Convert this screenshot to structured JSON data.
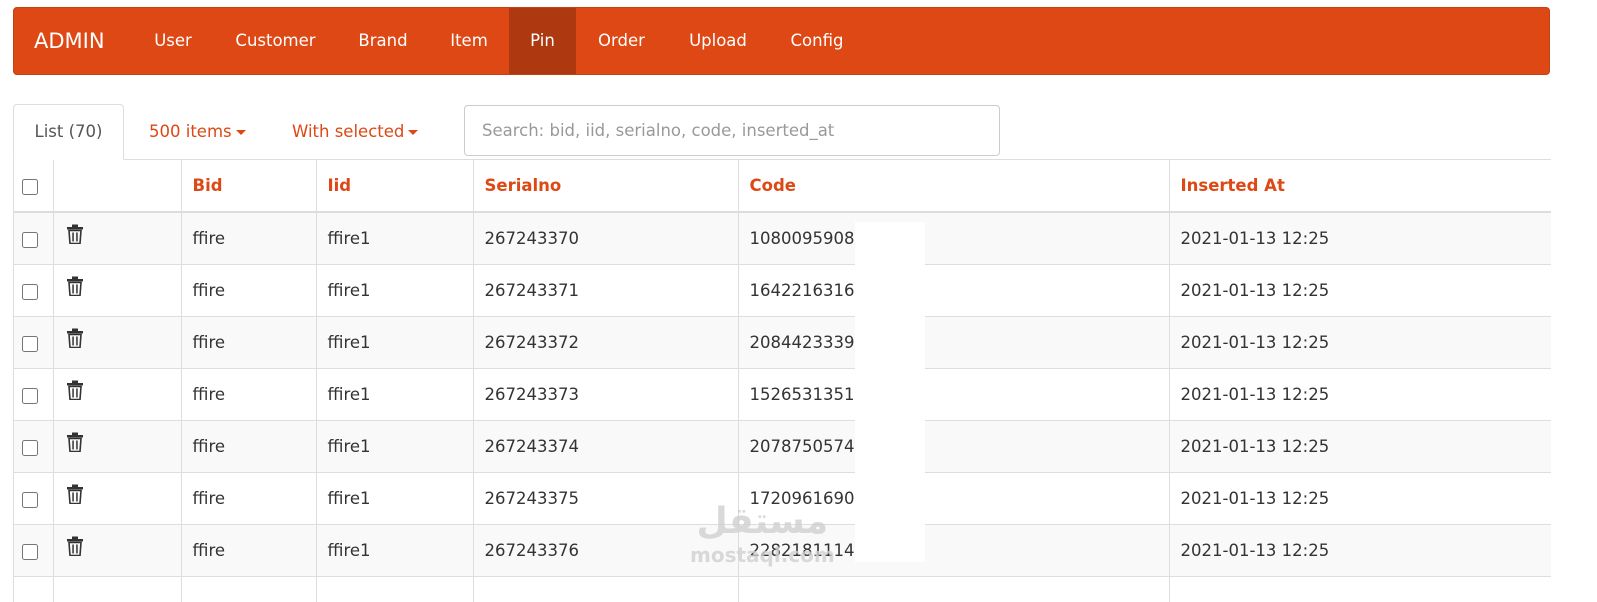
{
  "navbar": {
    "brand": "ADMIN",
    "items": [
      {
        "label": "User"
      },
      {
        "label": "Customer"
      },
      {
        "label": "Brand"
      },
      {
        "label": "Item"
      },
      {
        "label": "Pin"
      },
      {
        "label": "Order"
      },
      {
        "label": "Upload"
      },
      {
        "label": "Config"
      }
    ],
    "active": "Pin",
    "color": "#dd4814",
    "active_color": "#ae3910"
  },
  "toolbar": {
    "tab_label": "List (70)",
    "page_size_label": "500 items",
    "bulk_label": "With selected",
    "search_placeholder": "Search: bid, iid, serialno, code, inserted_at"
  },
  "table": {
    "columns": [
      "Bid",
      "Iid",
      "Serialno",
      "Code",
      "Inserted At"
    ],
    "rows": [
      {
        "bid": "ffire",
        "iid": "ffire1",
        "serialno": "267243370",
        "code": "1080095908",
        "inserted_at": "2021-01-13 12:25"
      },
      {
        "bid": "ffire",
        "iid": "ffire1",
        "serialno": "267243371",
        "code": "1642216316",
        "inserted_at": "2021-01-13 12:25"
      },
      {
        "bid": "ffire",
        "iid": "ffire1",
        "serialno": "267243372",
        "code": "2084423339",
        "inserted_at": "2021-01-13 12:25"
      },
      {
        "bid": "ffire",
        "iid": "ffire1",
        "serialno": "267243373",
        "code": "1526531351",
        "inserted_at": "2021-01-13 12:25"
      },
      {
        "bid": "ffire",
        "iid": "ffire1",
        "serialno": "267243374",
        "code": "2078750574",
        "inserted_at": "2021-01-13 12:25"
      },
      {
        "bid": "ffire",
        "iid": "ffire1",
        "serialno": "267243375",
        "code": "1720961690",
        "inserted_at": "2021-01-13 12:25"
      },
      {
        "bid": "ffire",
        "iid": "ffire1",
        "serialno": "267243376",
        "code": "2282181114",
        "inserted_at": "2021-01-13 12:25"
      }
    ],
    "header_color": "#dd4814",
    "row_icon": "trash-icon"
  },
  "watermark": {
    "logo": "مستقل",
    "text": "mostaql.com"
  }
}
